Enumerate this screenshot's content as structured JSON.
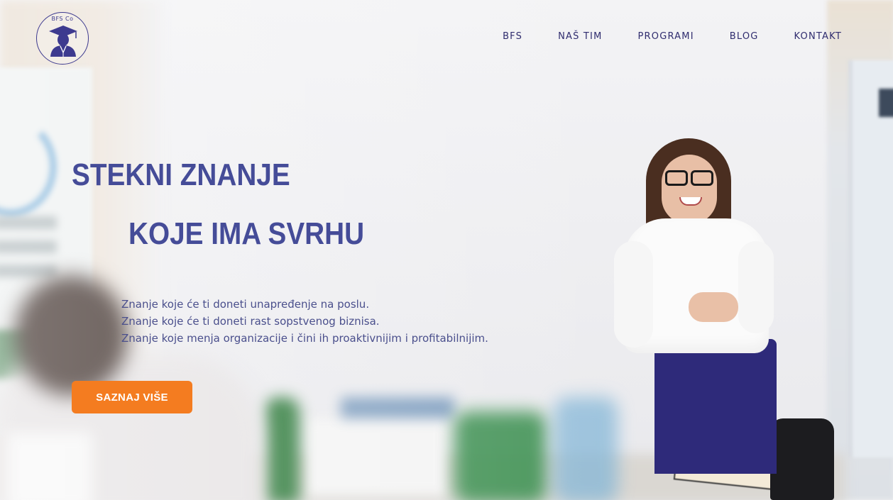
{
  "logo": {
    "text": "BFS Co",
    "icon": "graduate-cap-icon"
  },
  "nav": {
    "items": [
      {
        "label": "BFS"
      },
      {
        "label": "NAŠ TIM"
      },
      {
        "label": "PROGRAMI"
      },
      {
        "label": "BLOG"
      },
      {
        "label": "KONTAKT"
      }
    ]
  },
  "hero": {
    "headline_line1": "STEKNI ZNANJE",
    "headline_line2": "KOJE IMA SVRHU",
    "paragraph": [
      "Znanje koje će ti doneti unapređenje na poslu.",
      "Znanje koje će ti doneti rast sopstvenog biznisa.",
      "Znanje koje menja organizacije i čini ih proaktivnijim i profitabilnijim."
    ],
    "cta_label": "SAZNAJ VIŠE"
  },
  "colors": {
    "accent": "#f47c20",
    "brand": "#454c98",
    "nav_text": "#2f2c6e"
  }
}
